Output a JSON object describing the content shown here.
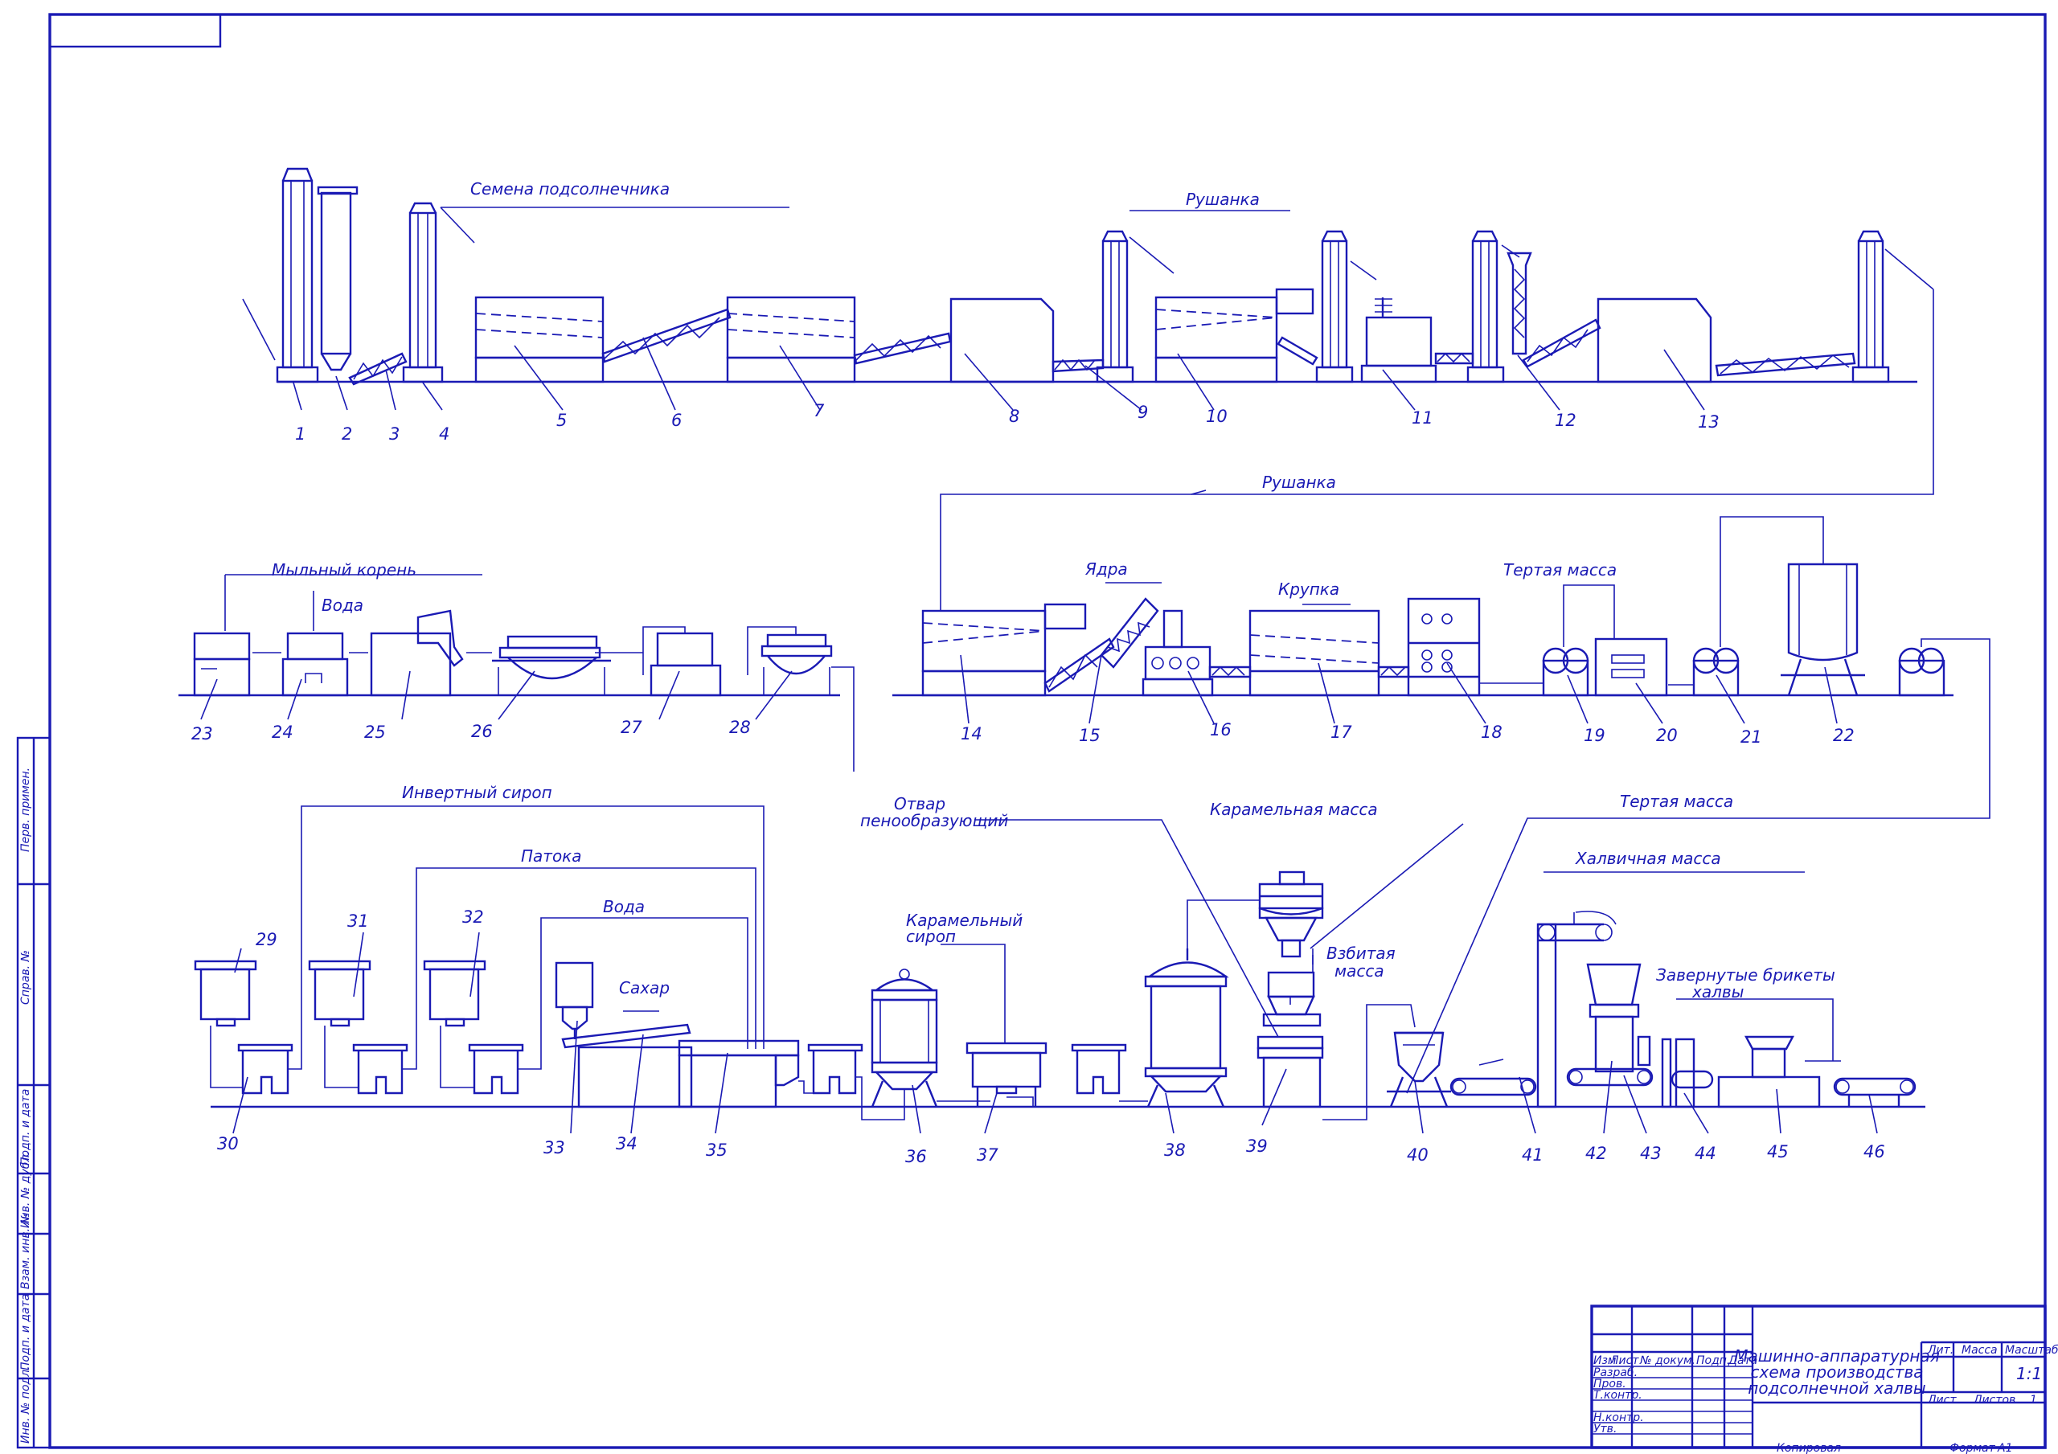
{
  "title_block": {
    "title_lines": [
      "Машинно-аппаратурная",
      "схема производства",
      "подсолнечной халвы"
    ],
    "header_cols": [
      "Изм",
      "Лист",
      "№ докум.",
      "Подп.",
      "Дата"
    ],
    "rows": [
      "Разраб.",
      "Пров.",
      "Т.контр.",
      "",
      "Н.контр.",
      "Утв."
    ],
    "lit_label": "Лит.",
    "mass_label": "Масса",
    "scale_label": "Масштаб",
    "scale_value": "1:1",
    "sheet_label": "Лист",
    "sheets_label": "Листов",
    "sheets_value": "1",
    "copied_label": "Копировал",
    "format_label": "Формат",
    "format_value": "A1"
  },
  "side_stamp": [
    "Перв. примен.",
    "Справ. №",
    "Подп. и дата",
    "Инв. № дубл.",
    "Взам. инв. №",
    "Подп. и дата",
    "Инв. № подл."
  ],
  "flow_labels": {
    "seeds": "Семена подсолнечника",
    "rushanka_top": "Рушанка",
    "rushanka_return": "Рушанка",
    "soap_root": "Мыльный корень",
    "water_row2": "Вода",
    "kernels": "Ядра",
    "groats": "Крупка",
    "ground_mass_1": "Тертая масса",
    "ground_mass_2": "Тертая масса",
    "invert_syrup": "Инвертный сироп",
    "treacle": "Патока",
    "water_row3": "Вода",
    "sugar": "Сахар",
    "caramel_syrup_1": "Карамельный",
    "caramel_syrup_2": "сироп",
    "foaming_decoction_1": "Отвар",
    "foaming_decoction_2": "пенообразующий",
    "caramel_mass": "Карамельная масса",
    "whipped_mass_1": "Взбитая",
    "whipped_mass_2": "масса",
    "halva_mass": "Халвичная масса",
    "wrapped_1": "Завернутые брикеты",
    "wrapped_2": "халвы"
  },
  "equipment_numbers": [
    "1",
    "2",
    "3",
    "4",
    "5",
    "6",
    "7",
    "8",
    "9",
    "10",
    "11",
    "12",
    "13",
    "14",
    "15",
    "16",
    "17",
    "18",
    "19",
    "20",
    "21",
    "22",
    "23",
    "24",
    "25",
    "26",
    "27",
    "28",
    "29",
    "30",
    "31",
    "32",
    "33",
    "34",
    "35",
    "36",
    "37",
    "38",
    "39",
    "40",
    "41",
    "42",
    "43",
    "44",
    "45",
    "46"
  ]
}
